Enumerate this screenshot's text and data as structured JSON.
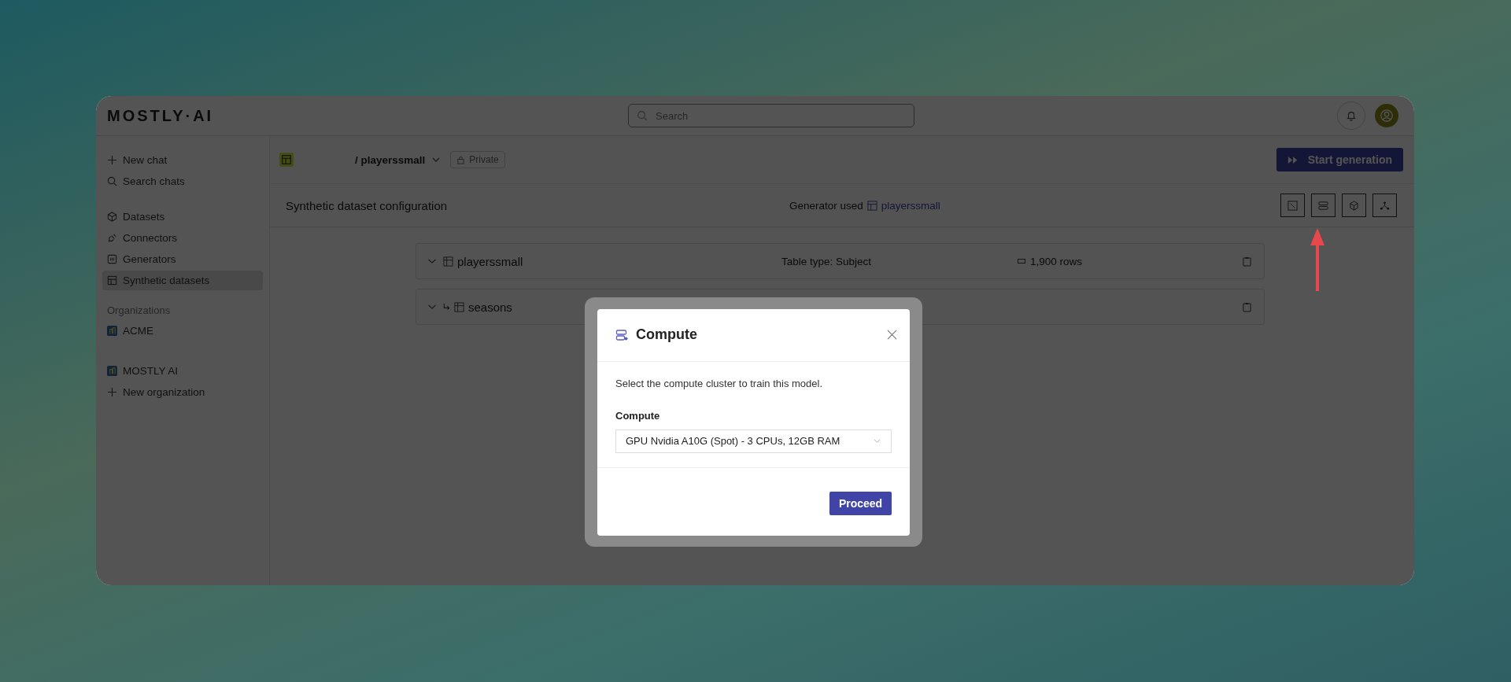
{
  "header": {
    "logo": "MOSTLY·AI",
    "search": {
      "placeholder": "Search"
    }
  },
  "sidebar": {
    "items": [
      {
        "label": "New chat",
        "kind": "plus",
        "selected": false
      },
      {
        "label": "Search chats",
        "kind": "search",
        "selected": false
      },
      {
        "label": "Datasets",
        "kind": "cube",
        "selected": false
      },
      {
        "label": "Connectors",
        "kind": "plug",
        "selected": false
      },
      {
        "label": "Generators",
        "kind": "chip",
        "selected": false
      },
      {
        "label": "Synthetic datasets",
        "kind": "grid",
        "selected": true
      }
    ],
    "organizations": {
      "heading": "Organizations",
      "items": [
        {
          "label": "ACME",
          "kind": "org"
        },
        {
          "label": "MOSTLY AI",
          "kind": "org"
        },
        {
          "label": "New organization",
          "kind": "plus"
        }
      ]
    }
  },
  "toolbar": {
    "breadcrumb": "/ playerssmall",
    "badge": "Private",
    "primary_button": "Start generation"
  },
  "config": {
    "title": "Synthetic dataset configuration",
    "generator_label": "Generator used",
    "generator_link": "playerssmall"
  },
  "tables": [
    {
      "name": "playerssmall",
      "linked": false,
      "table_type": "Table type: Subject",
      "rows": "1,900 rows"
    },
    {
      "name": "seasons",
      "linked": true
    }
  ],
  "modal": {
    "title": "Compute",
    "description": "Select the compute cluster to train this model.",
    "field_label": "Compute",
    "value": "GPU Nvidia A10G (Spot) - 3 CPUs, 12GB RAM",
    "button": "Proceed"
  }
}
